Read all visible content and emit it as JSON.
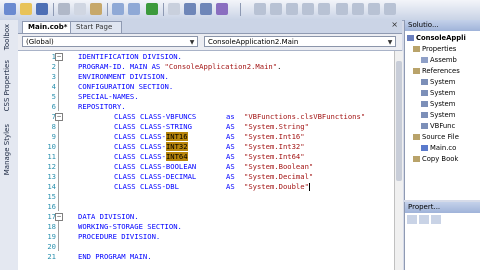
{
  "tabs": [
    {
      "label": "Main.cob*"
    },
    {
      "label": "Start Page"
    }
  ],
  "tab_close": "×",
  "nav": {
    "left_dropdown": "(Global)",
    "right_dropdown": "ConsoleApplication2.Main"
  },
  "left_strip": {
    "toolbox": "Toolbox",
    "css_properties": "CSS Properties",
    "manage_styles": "Manage Styles"
  },
  "code_lines": [
    {
      "n": "1",
      "text": "IDENTIFICATION DIVISION."
    },
    {
      "n": "2",
      "text": "PROGRAM-ID. MAIN AS \"ConsoleApplication2.Main\"."
    },
    {
      "n": "3",
      "text": "ENVIRONMENT DIVISION."
    },
    {
      "n": "4",
      "text": "CONFIGURATION SECTION."
    },
    {
      "n": "5",
      "text": "SPECIAL-NAMES."
    },
    {
      "n": "6",
      "text": "REPOSITORY."
    },
    {
      "n": "7",
      "text": "    CLASS CLASS-VBFUNCS    as \"VBFunctions.clsVBFunctions\""
    },
    {
      "n": "8",
      "text": "    CLASS CLASS-STRING     AS \"System.String\""
    },
    {
      "n": "9",
      "text": "    CLASS CLASS-INT16      AS \"System.Int16\""
    },
    {
      "n": "10",
      "text": "    CLASS CLASS-INT32      AS \"System.Int32\""
    },
    {
      "n": "11",
      "text": "    CLASS CLASS-INT64      AS \"System.Int64\""
    },
    {
      "n": "12",
      "text": "    CLASS CLASS-BOOLEAN    AS \"System.Boolean\""
    },
    {
      "n": "13",
      "text": "    CLASS CLASS-DECIMAL    AS \"System.Decimal\""
    },
    {
      "n": "14",
      "text": "    CLASS CLASS-DBL        AS \"System.Double\""
    },
    {
      "n": "15",
      "text": ""
    },
    {
      "n": "16",
      "text": ""
    },
    {
      "n": "17",
      "text": "DATA DIVISION."
    },
    {
      "n": "18",
      "text": "WORKING-STORAGE SECTION."
    },
    {
      "n": "19",
      "text": "PROCEDURE DIVISION."
    },
    {
      "n": "20",
      "text": ""
    },
    {
      "n": "21",
      "text": "END PROGRAM MAIN."
    }
  ],
  "code": {
    "l7a": "CLASS CLASS-VBFUNCS",
    "l7b": "as",
    "l7c": "\"VBFunctions.clsVBFunctions\"",
    "l8a": "CLASS CLASS-STRING",
    "l8b": "AS",
    "l8c": "\"System.String\"",
    "l9a": "CLASS CLASS-",
    "l9h": "INT16",
    "l9b": "AS",
    "l9c": "\"System.Int16\"",
    "l10a": "CLASS CLASS-",
    "l10h": "INT32",
    "l10b": "AS",
    "l10c": "\"System.Int32\"",
    "l11a": "CLASS CLASS-",
    "l11h": "INT64",
    "l11b": "AS",
    "l11c": "\"System.Int64\"",
    "l12a": "CLASS CLASS-BOOLEAN",
    "l12b": "AS",
    "l12c": "\"System.Boolean\"",
    "l13a": "CLASS CLASS-DECIMAL",
    "l13b": "AS",
    "l13c": "\"System.Decimal\"",
    "l14a": "CLASS CLASS-DBL",
    "l14b": "AS",
    "l14c": "\"System.Double\""
  },
  "solution_pane": {
    "title": "Solutio...",
    "items": [
      "ConsoleAppli",
      "Properties",
      "Assemb",
      "References",
      "System",
      "System",
      "System",
      "System",
      "VBFunc",
      "Source File",
      "Main.co",
      "Copy Book"
    ]
  },
  "properties_pane": {
    "title": "Propert..."
  },
  "colors": {
    "keyword": "#0000ff",
    "string": "#a31515",
    "line_number": "#2b91af",
    "highlight": "#b8860b"
  }
}
